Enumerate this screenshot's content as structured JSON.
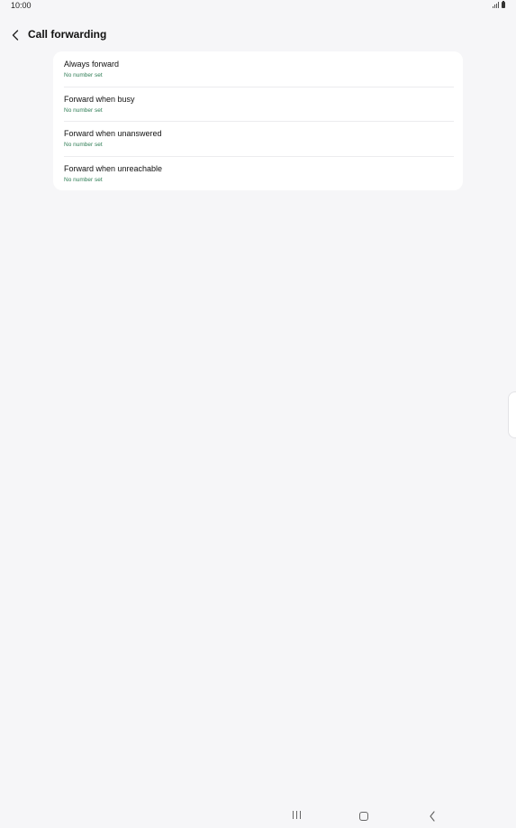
{
  "status_bar": {
    "time": "10:00",
    "icons": [
      "signal-icon",
      "battery-icon"
    ]
  },
  "header": {
    "back_icon": "chevron-left-icon",
    "title": "Call forwarding"
  },
  "forwarding_options": [
    {
      "label": "Always forward",
      "status": "No number set"
    },
    {
      "label": "Forward when busy",
      "status": "No number set"
    },
    {
      "label": "Forward when unanswered",
      "status": "No number set"
    },
    {
      "label": "Forward when unreachable",
      "status": "No number set"
    }
  ],
  "navigation_bar": {
    "icons": [
      "recents-icon",
      "home-icon",
      "back-icon"
    ]
  },
  "colors": {
    "background": "#f6f6f8",
    "card": "#ffffff",
    "status_text": "#2f7d55"
  }
}
